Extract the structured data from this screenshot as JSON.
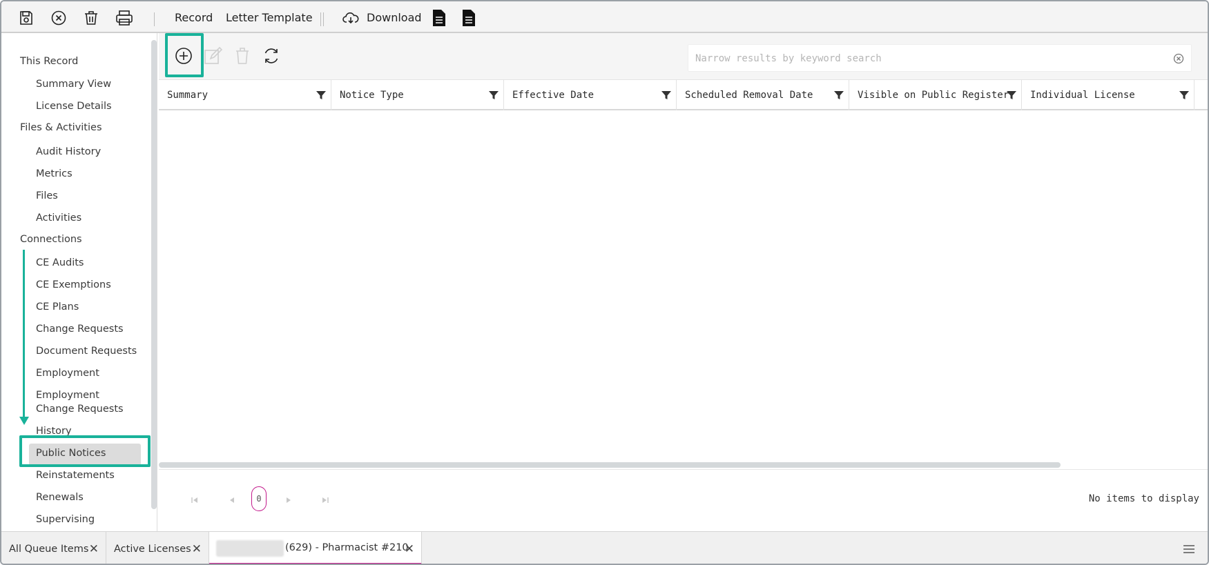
{
  "toolbar": {
    "icons": [
      "save-icon",
      "close-circle-icon",
      "trash-icon",
      "print-icon",
      "cloud-download-icon",
      "document-icon",
      "document-icon"
    ],
    "record_label": "Record",
    "letter_template_label": "Letter Template",
    "download_label": "Download"
  },
  "sidebar": {
    "groups": [
      {
        "label": "This Record",
        "items": [
          "Summary View",
          "License Details"
        ]
      },
      {
        "label": "Files & Activities",
        "items": [
          "Audit History",
          "Metrics",
          "Files",
          "Activities"
        ]
      },
      {
        "label": "Connections",
        "items": [
          "CE Audits",
          "CE Exemptions",
          "CE Plans",
          "Change Requests",
          "Document Requests",
          "Employment",
          "Employment Change Requests",
          "History",
          "Public Notices",
          "Reinstatements",
          "Renewals",
          "Supervising"
        ]
      }
    ],
    "active_item": "Public Notices"
  },
  "main": {
    "toolbar_icons": [
      "add-icon",
      "edit-icon",
      "delete-icon",
      "refresh-icon"
    ],
    "search": {
      "placeholder": "Narrow results by keyword search",
      "value": ""
    },
    "columns": [
      "Summary",
      "Notice Type",
      "Effective Date",
      "Scheduled Removal Date",
      "Visible on Public Register",
      "Individual License"
    ],
    "rows": [],
    "pager": {
      "current_page": "0",
      "info": "No items to display"
    }
  },
  "bottom_tabs": [
    {
      "label": "All Queue Items",
      "active": false
    },
    {
      "label": "Active Licenses",
      "active": false
    },
    {
      "label": "(629) - Pharmacist #210",
      "active": true
    }
  ],
  "colors": {
    "highlight": "#19b29a",
    "active_tab_underline": "#c2188b"
  }
}
